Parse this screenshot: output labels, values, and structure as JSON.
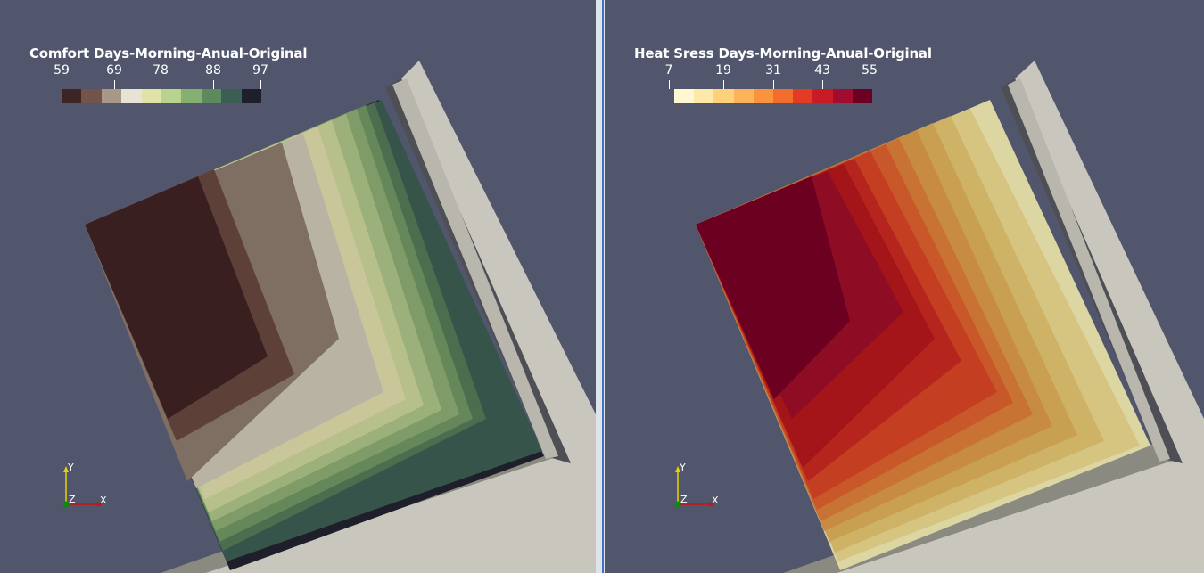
{
  "views": [
    {
      "title": "Comfort Days-Morning-Anual-Original",
      "ticks": [
        "59",
        "69",
        "78",
        "88",
        "97"
      ],
      "colormap": [
        "#3d2425",
        "#74534a",
        "#a79888",
        "#e7e3d5",
        "#dfe3a8",
        "#b9d28e",
        "#86b071",
        "#5c8a5c",
        "#3a5e54",
        "#1e1f2a"
      ],
      "contour_colors": [
        "#3a1f21",
        "#5d4037",
        "#7f6e62",
        "#b8b3a3",
        "#c9c79a",
        "#b7c08a",
        "#9bb07a",
        "#7f9c68",
        "#65875a",
        "#4c6e4f",
        "#37544a",
        "#1e1f2a"
      ],
      "axes": {
        "y": "Y",
        "x": "X",
        "z": "Z"
      }
    },
    {
      "title": "Heat Sress Days-Morning-Anual-Original",
      "ticks": [
        "7",
        "19",
        "31",
        "43",
        "55"
      ],
      "colormap": [
        "#fff8d0",
        "#fee9a8",
        "#fdd17b",
        "#fcb458",
        "#f9933f",
        "#f26c2e",
        "#e43b25",
        "#c81b26",
        "#a20c2e",
        "#6c0022"
      ],
      "contour_colors": [
        "#6c0020",
        "#8e0d24",
        "#a31519",
        "#b5241d",
        "#c43e22",
        "#c8582a",
        "#c87234",
        "#c78b42",
        "#c9a052",
        "#ceb366",
        "#d6c581",
        "#dcd6a3"
      ],
      "axes": {
        "y": "Y",
        "x": "X",
        "z": "Z"
      }
    }
  ]
}
